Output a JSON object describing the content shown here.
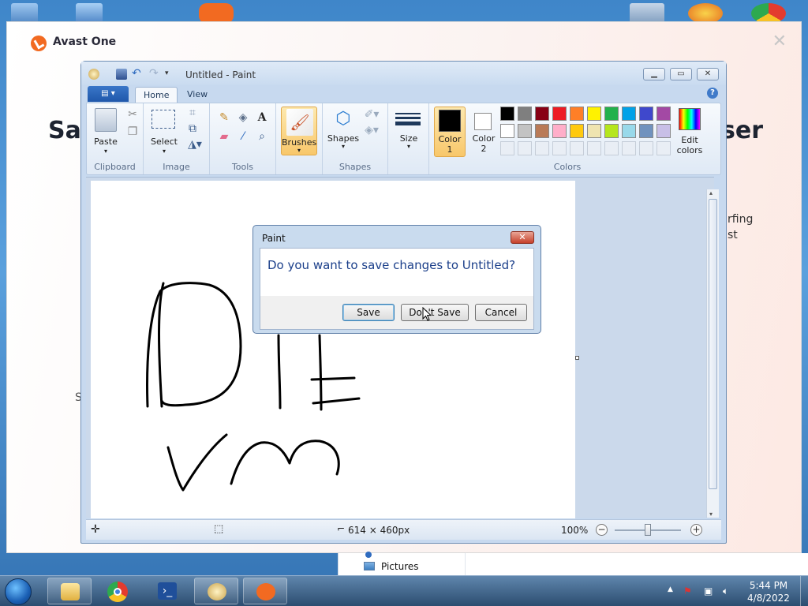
{
  "avast": {
    "title": "Avast One",
    "close_glyph": "✕",
    "heading_left": "Sa",
    "heading_right": "ser",
    "body_right_line1": "rfing",
    "body_right_line2": "st",
    "side_left": "S"
  },
  "paint": {
    "window_title": "Untitled - Paint",
    "tabs": [
      {
        "label": "Home"
      },
      {
        "label": "View"
      }
    ],
    "help_glyph": "?",
    "groups": {
      "clipboard": {
        "label": "Clipboard",
        "paste": "Paste"
      },
      "image": {
        "label": "Image",
        "select": "Select"
      },
      "tools": {
        "label": "Tools"
      },
      "brushes": {
        "label": "Brushes"
      },
      "shapes": {
        "label": "Shapes",
        "shapes_btn": "Shapes"
      },
      "size": {
        "label": "Size"
      },
      "colors": {
        "label": "Colors",
        "color1_line1": "Color",
        "color1_line2": "1",
        "color2_line1": "Color",
        "color2_line2": "2",
        "edit_line1": "Edit",
        "edit_line2": "colors",
        "color1_value": "#000000",
        "color2_value": "#ffffff",
        "palette_row1": [
          "#000000",
          "#7f7f7f",
          "#880015",
          "#ed1c24",
          "#ff7f27",
          "#fff200",
          "#22b14c",
          "#00a2e8",
          "#3f48cc",
          "#a349a4"
        ],
        "palette_row2": [
          "#ffffff",
          "#c3c3c3",
          "#b97a57",
          "#ffaec9",
          "#ffc90e",
          "#efe4b0",
          "#b5e61d",
          "#99d9ea",
          "#7092be",
          "#c8bfe7"
        ]
      }
    },
    "status": {
      "dimensions": "614 × 460px",
      "zoom": "100%",
      "zoom_fraction": 0.5
    }
  },
  "dialog": {
    "title": "Paint",
    "message": "Do you want to save changes to Untitled?",
    "save": "Save",
    "dont_save": "Don't Save",
    "cancel": "Cancel"
  },
  "explorer": {
    "pictures": "Pictures"
  },
  "taskbar": {
    "time": "5:44 PM",
    "date": "4/8/2022"
  },
  "icons": [
    "paint-icon",
    "save-icon",
    "undo-icon",
    "redo-icon",
    "paste-icon",
    "cut-icon",
    "copy-icon",
    "select-icon",
    "crop-icon",
    "resize-icon",
    "rotate-icon",
    "pencil-icon",
    "fill-icon",
    "text-icon",
    "eraser-icon",
    "color-picker-icon",
    "magnifier-icon",
    "brush-icon",
    "shapes-icon",
    "outline-icon",
    "fill-shape-icon",
    "size-icon",
    "edit-colors-icon",
    "move-icon",
    "selection-size-icon",
    "canvas-size-icon",
    "zoom-out-icon",
    "zoom-in-icon",
    "start-icon",
    "explorer-icon",
    "chrome-icon",
    "powershell-icon",
    "avast-icon",
    "network-icon",
    "volume-icon",
    "flag-icon"
  ]
}
